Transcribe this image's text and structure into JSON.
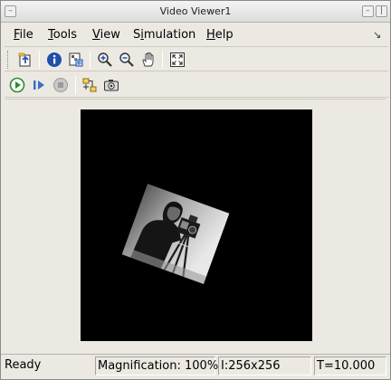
{
  "window": {
    "title": "Video Viewer1"
  },
  "menu": [
    {
      "label": "File",
      "mnemonic": "F",
      "rest": "ile"
    },
    {
      "label": "Tools",
      "mnemonic": "T",
      "rest": "ools"
    },
    {
      "label": "View",
      "mnemonic": "V",
      "rest": "iew"
    },
    {
      "label": "Simulation",
      "pre": "S",
      "mnemonic": "i",
      "rest": "mulation"
    },
    {
      "label": "Help",
      "mnemonic": "H",
      "rest": "elp"
    }
  ],
  "dock_arrow": "↘",
  "toolbar1": {
    "buttons": [
      "open-icon",
      "info-icon",
      "pixel-region-icon",
      "zoom-in-icon",
      "zoom-out-icon",
      "pan-hand-icon",
      "fit-to-window-icon"
    ]
  },
  "toolbar2": {
    "buttons": [
      "play-icon",
      "step-forward-icon",
      "stop-icon",
      "highlight-simulink-signal-icon",
      "snapshot-icon"
    ]
  },
  "colors": {
    "play_green": "#2e8b2e",
    "step_blue": "#3a6fc4",
    "stop_grey": "#9a9a9a"
  },
  "status": {
    "state": "Ready",
    "magnification": "Magnification: 100%",
    "image_info": "I:256x256",
    "time": "T=10.000"
  }
}
